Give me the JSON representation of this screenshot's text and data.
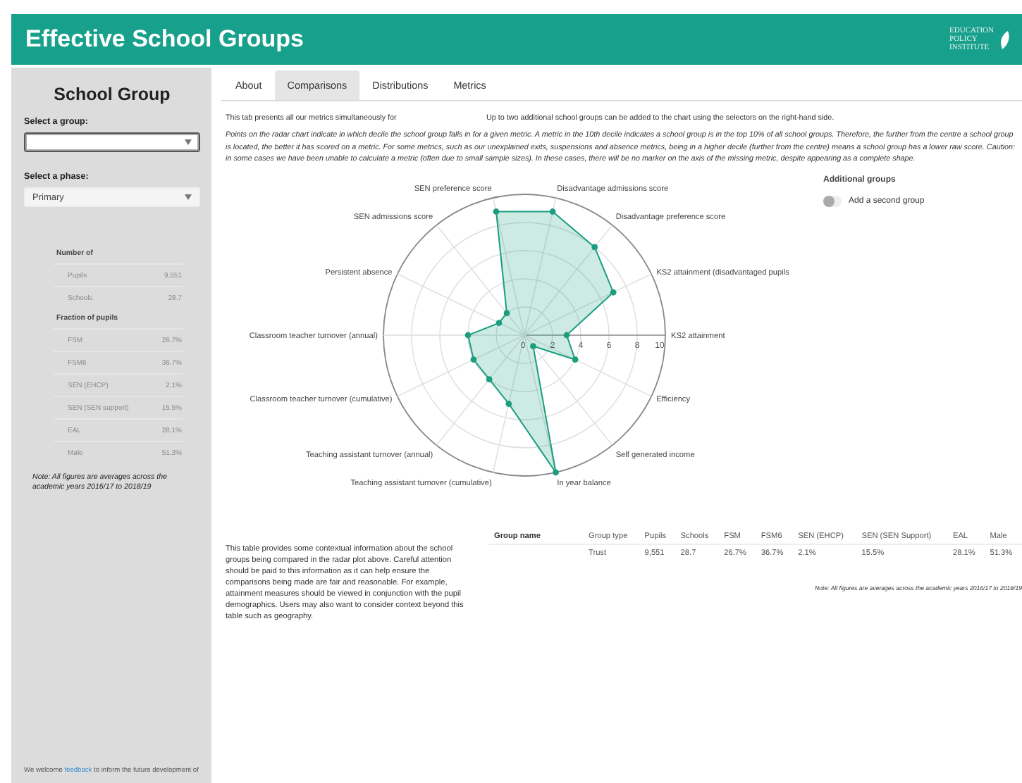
{
  "header": {
    "title": "Effective School Groups",
    "logo_lines": [
      "EDUCATION",
      "POLICY",
      "INSTITUTE"
    ]
  },
  "sidebar": {
    "title": "School Group",
    "group_select": {
      "label": "Select a group:"
    },
    "phase_select": {
      "label": "Select a phase:",
      "value": "Primary"
    },
    "summary": [
      {
        "heading": "Number of",
        "rows": [
          {
            "label": "Pupils",
            "value": "9,551"
          },
          {
            "label": "Schools",
            "value": "28.7"
          }
        ]
      },
      {
        "heading": "Fraction of pupils",
        "rows": [
          {
            "label": "FSM",
            "value": "26.7%"
          },
          {
            "label": "FSM6",
            "value": "36.7%"
          },
          {
            "label": "SEN (EHCP)",
            "value": "2.1%"
          },
          {
            "label": "SEN (SEN support)",
            "value": "15.5%"
          },
          {
            "label": "EAL",
            "value": "28.1%"
          },
          {
            "label": "Male",
            "value": "51.3%"
          }
        ]
      }
    ],
    "note": "Note: All figures are averages across the academic years 2016/17 to 2018/19",
    "feedback": {
      "before": "We welcome",
      "link": "feedback",
      "after": "to inform the future development of"
    }
  },
  "tabs": [
    {
      "label": "About",
      "selected": false
    },
    {
      "label": "Comparisons",
      "selected": true
    },
    {
      "label": "Distributions",
      "selected": false
    },
    {
      "label": "Metrics",
      "selected": false
    }
  ],
  "intro": [
    "This tab presents all our metrics simultaneously for",
    "Up to two additional school groups can be added to the chart using the selectors on the right-hand side."
  ],
  "explanation": "Points on the radar chart indicate in which decile the school group falls in for a given metric. A metric in the 10th decile indicates a school group is in the top 10% of all school groups. Therefore, the further from the centre a school group is located, the better it has scored on a metric. For some metrics, such as our unexplained exits, suspensions and absence metrics, being in a higher decile (further from the centre) means a school group has a lower raw score. Caution: in some cases we have been unable to calculate a metric (often due to small sample sizes). In these cases, there will be no marker on the axis of the missing metric, despite appearing as a complete shape.",
  "radar": {
    "scale_labels": [
      "0",
      "2",
      "4",
      "6",
      "8",
      "10"
    ],
    "axis_labels": [
      "SEN preference score",
      "Disadvantage admissions score",
      "SEN admissions score",
      "Disadvantage preference score",
      "Persistent absence",
      "KS2 attainment (disadvantaged pupils",
      "Classroom teacher turnover (annual)",
      "KS2 attainment",
      "Classroom teacher turnover (cumulative)",
      "Efficiency",
      "Teaching assistant turnover (annual)",
      "Self generated income",
      "Teaching assistant turnover (cumulative)",
      "In year balance"
    ]
  },
  "additional_groups": {
    "title": "Additional groups",
    "toggle": {
      "label": "Add a second group",
      "on": false
    }
  },
  "context": {
    "text": "This table provides some contextual information about the school groups being compared in the radar plot above. Careful attention should be paid to this information as it can help ensure the comparisons being made are fair and reasonable. For example, attainment measures should be viewed in conjunction with the pupil demographics. Users may also want to consider context beyond this table such as geography.",
    "table": {
      "columns": [
        "Group name",
        "Group type",
        "Pupils",
        "Schools",
        "FSM",
        "FSM6",
        "SEN (EHCP)",
        "SEN (SEN Support)",
        "EAL",
        "Male"
      ],
      "rows": [
        [
          null,
          "Trust",
          "9,551",
          "28.7",
          "26.7%",
          "36.7%",
          "2.1%",
          "15.5%",
          "28.1%",
          "51.3%"
        ]
      ]
    },
    "note": "Note: All figures are averages across the academic years 2016/17 to 2018/19"
  }
}
